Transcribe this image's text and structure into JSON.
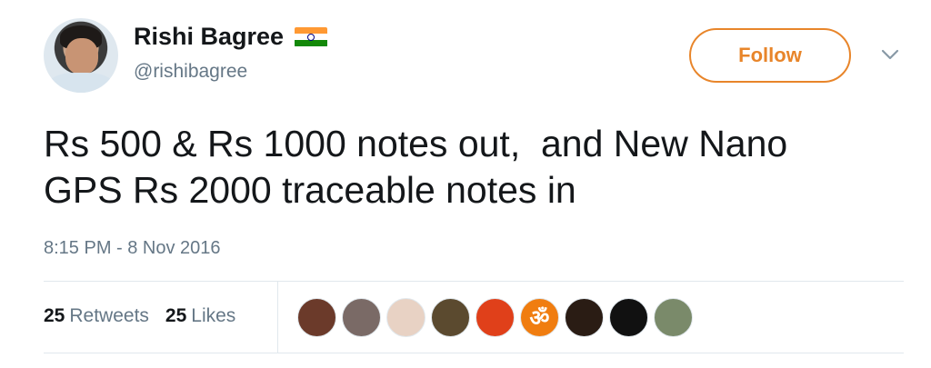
{
  "author": {
    "display_name": "Rishi Bagree",
    "handle": "@rishibagree",
    "badge_icon": "india-flag-icon"
  },
  "follow_button": {
    "label": "Follow",
    "color": "#e8852a"
  },
  "menu": {
    "icon": "chevron-down-icon"
  },
  "tweet": {
    "text": "Rs 500 & Rs 1000 notes out,  and New Nano\nGPS Rs 2000 traceable notes in",
    "timestamp": "8:15 PM - 8 Nov 2016"
  },
  "stats": {
    "retweets_count": "25",
    "retweets_label": "Retweets",
    "likes_count": "25",
    "likes_label": "Likes"
  },
  "likers": [
    {
      "icon": "liker-avatar-1",
      "bg": "#6b3a2a"
    },
    {
      "icon": "liker-avatar-2",
      "bg": "#7a6a66"
    },
    {
      "icon": "liker-avatar-3",
      "bg": "#e8d2c4"
    },
    {
      "icon": "liker-avatar-4",
      "bg": "#5b4a2f"
    },
    {
      "icon": "liker-avatar-5",
      "bg": "#e0401a"
    },
    {
      "icon": "om-icon",
      "bg": "#f07d10"
    },
    {
      "icon": "liker-avatar-7",
      "bg": "#2a1c14"
    },
    {
      "icon": "liker-avatar-8",
      "bg": "#111111"
    },
    {
      "icon": "liker-avatar-9",
      "bg": "#7a8a6a"
    }
  ]
}
